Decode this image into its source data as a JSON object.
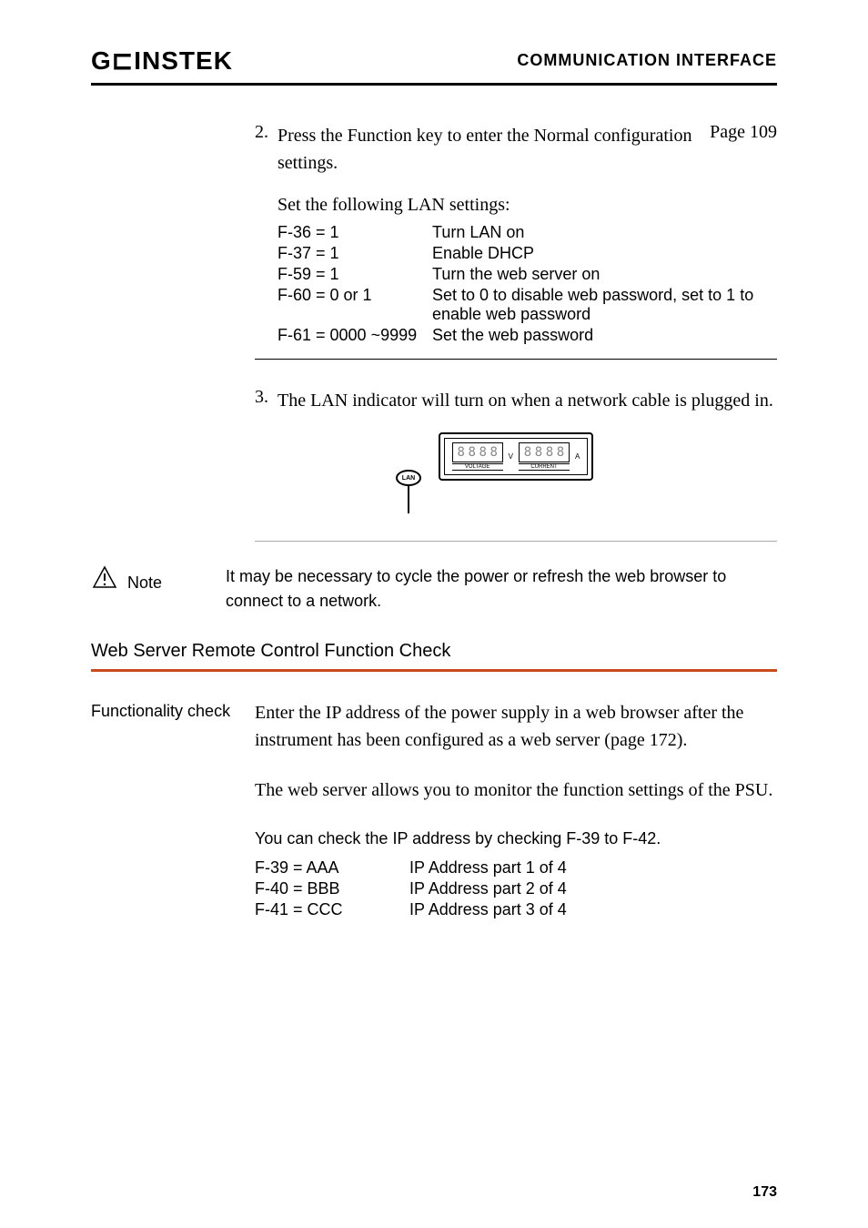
{
  "header": {
    "logo": "G⊏INSTEK",
    "title": "COMMUNICATION INTERFACE"
  },
  "step2": {
    "num": "2.",
    "text": "Press the Function key to enter the Normal configuration settings.",
    "page_ref": "Page 109",
    "intro": "Set the following LAN settings:",
    "settings": [
      {
        "key": "F-36 = 1",
        "val": "Turn LAN on"
      },
      {
        "key": "F-37 = 1",
        "val": "Enable DHCP"
      },
      {
        "key": "F-59 = 1",
        "val": "Turn the web server on"
      },
      {
        "key": "F-60 = 0 or 1",
        "val": "Set to 0 to disable web password, set to 1 to enable web password"
      },
      {
        "key": "F-61 =  0000 ~9999",
        "val": "Set the web password"
      }
    ]
  },
  "step3": {
    "num": "3.",
    "text": "The LAN indicator will turn on when a network cable is plugged in."
  },
  "display": {
    "voltage_label": "VOLTAGE",
    "current_label": "CURRENT",
    "v_unit": "V",
    "a_unit": "A",
    "lan_label": "LAN"
  },
  "note": {
    "label": "Note",
    "text": "It may be necessary to cycle the power or refresh the web browser to connect to a network."
  },
  "section_heading": "Web Server Remote Control Function Check",
  "functionality": {
    "label": "Functionality check",
    "para1": "Enter the IP address of the power supply in a web browser after the instrument has been configured as a web server (page 172).",
    "para2": "The web server allows you to monitor the function settings of the PSU.",
    "ip_intro": "You can check the IP address by checking F-39 to F-42.",
    "ip_rows": [
      {
        "key": "F-39 = AAA",
        "val": "IP Address part 1 of 4"
      },
      {
        "key": "F-40 = BBB",
        "val": "IP Address part 2 of 4"
      },
      {
        "key": "F-41 =  CCC",
        "val": "IP Address part 3 of 4"
      }
    ]
  },
  "page_number": "173"
}
